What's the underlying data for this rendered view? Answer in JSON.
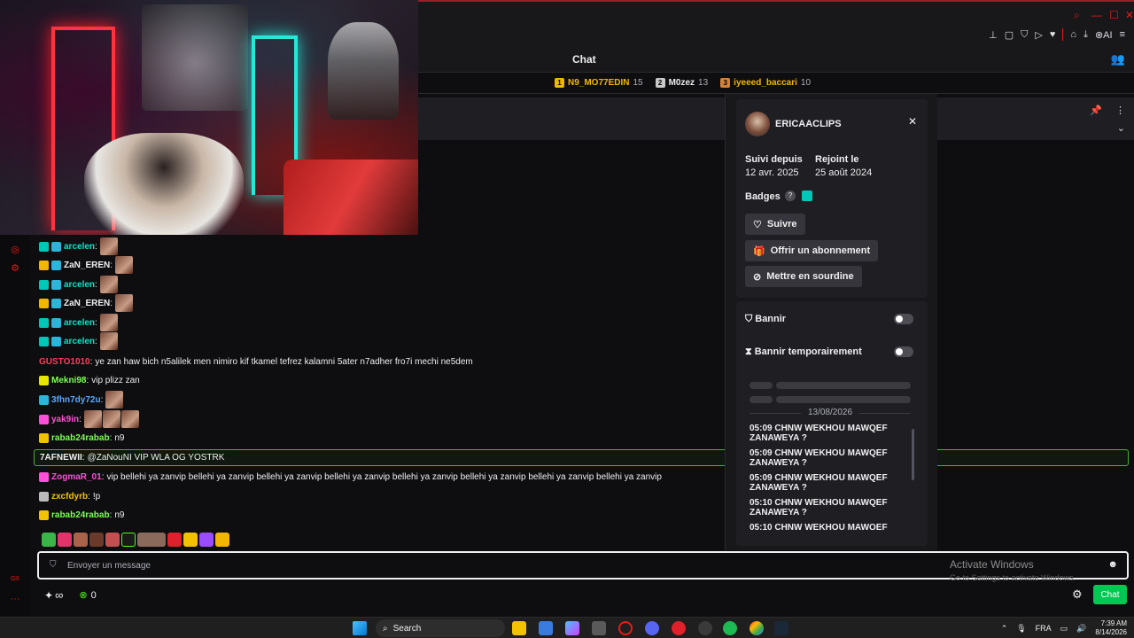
{
  "chat": {
    "title": "Chat",
    "leaderboard": [
      {
        "rank": "1",
        "name": "N9_MO77EDIN",
        "count": "15",
        "color": "#f2b600",
        "badge_color": "#f2b600"
      },
      {
        "rank": "2",
        "name": "M0zez",
        "count": "13",
        "color": "#efeff1",
        "badge_color": "#c9c9c9"
      },
      {
        "rank": "3",
        "name": "iyeeed_baccari",
        "count": "10",
        "color": "#f2b600",
        "badge_color": "#d2823a"
      }
    ],
    "messages": [
      {
        "badges": [
          "42",
          "sub"
        ],
        "user": "arcelen",
        "color": "#00e5c8",
        "text": "",
        "emotes": 1
      },
      {
        "badges": [
          "1",
          "sub"
        ],
        "user": "ZaN_EREN",
        "color": "#efeff1",
        "text": "",
        "emotes": 1
      },
      {
        "badges": [
          "42",
          "sub"
        ],
        "user": "arcelen",
        "color": "#00e5c8",
        "text": "",
        "emotes": 1
      },
      {
        "badges": [
          "1",
          "sub"
        ],
        "user": "ZaN_EREN",
        "color": "#efeff1",
        "text": "",
        "emotes": 1
      },
      {
        "badges": [
          "42",
          "sub"
        ],
        "user": "arcelen",
        "color": "#00e5c8",
        "text": "",
        "emotes": 1
      },
      {
        "badges": [
          "42",
          "sub"
        ],
        "user": "arcelen",
        "color": "#00e5c8",
        "text": "",
        "emotes": 1
      },
      {
        "badges": [],
        "user": "GUSTO1010",
        "color": "#ff3b5c",
        "text": "ye zan haw bich n5alilek men nimiro kif tkamel tefrez kalamni 5ater n7adher fro7i mechi ne5dem",
        "emotes": 0
      },
      {
        "badges": [
          "19"
        ],
        "user": "Mekni98",
        "color": "#7cff52",
        "text": "vip plizz zan",
        "emotes": 0
      },
      {
        "badges": [
          "sub"
        ],
        "user": "3fhn7dy72u",
        "color": "#5aa9ff",
        "text": "",
        "emotes": 1
      },
      {
        "badges": [
          "face"
        ],
        "user": "yak9in",
        "color": "#ff4fd8",
        "text": "",
        "emotes": 3
      },
      {
        "badges": [
          "cat"
        ],
        "user": "rabab24rabab",
        "color": "#7cff52",
        "text": "n9",
        "emotes": 0
      },
      {
        "badges": [],
        "user": "7AFNEWII",
        "color": "#efeff1",
        "text": "@ZaNouNI VIP WLA OG YOSTRK",
        "emotes": 0,
        "highlight": true
      },
      {
        "badges": [
          "face"
        ],
        "user": "ZogmaR_01",
        "color": "#ff4fd8",
        "text": "vip bellehi ya zanvip bellehi ya zanvip bellehi ya zanvip bellehi ya zanvip bellehi ya zanvip bellehi ya zanvip bellehi ya zanvip bellehi ya zanvip",
        "emotes": 0
      },
      {
        "badges": [
          "gray"
        ],
        "user": "zxcfdyrb",
        "color": "#f2c200",
        "text": "!p",
        "emotes": 0
      },
      {
        "badges": [
          "cat"
        ],
        "user": "rabab24rabab",
        "color": "#7cff52",
        "text": "n9",
        "emotes": 0
      }
    ],
    "input_placeholder": "Envoyer un message",
    "infinity_label": "∞",
    "points": "0",
    "send_label": "Chat",
    "windows_watermark": "Activate Windows",
    "windows_watermark_sub": "Go to Settings to activate Windows."
  },
  "usercard": {
    "username": "ERICAACLIPS",
    "followed_label": "Suivi depuis",
    "followed_date": "12 avr. 2025",
    "joined_label": "Rejoint le",
    "joined_date": "25 août 2024",
    "badges_label": "Badges",
    "follow_button": "Suivre",
    "gift_button": "Offrir un abonnement",
    "mute_button": "Mettre en sourdine",
    "ban_label": "Bannir",
    "timeout_label": "Bannir temporairement",
    "date": "13/08/2026",
    "history": [
      "05:09 CHNW WEKHOU MAWQEF ZANAWEYA ?",
      "05:09 CHNW WEKHOU MAWQEF ZANAWEYA ?",
      "05:09 CHNW WEKHOU MAWQEF ZANAWEYA ?",
      "05:10 CHNW WEKHOU MAWQEF ZANAWEYA ?",
      "05:10 CHNW WEKHOU MAWQEF"
    ]
  },
  "taskbar": {
    "search_placeholder": "Search",
    "language": "FRA",
    "time": "7:39 AM",
    "date": "8/14/2026"
  }
}
